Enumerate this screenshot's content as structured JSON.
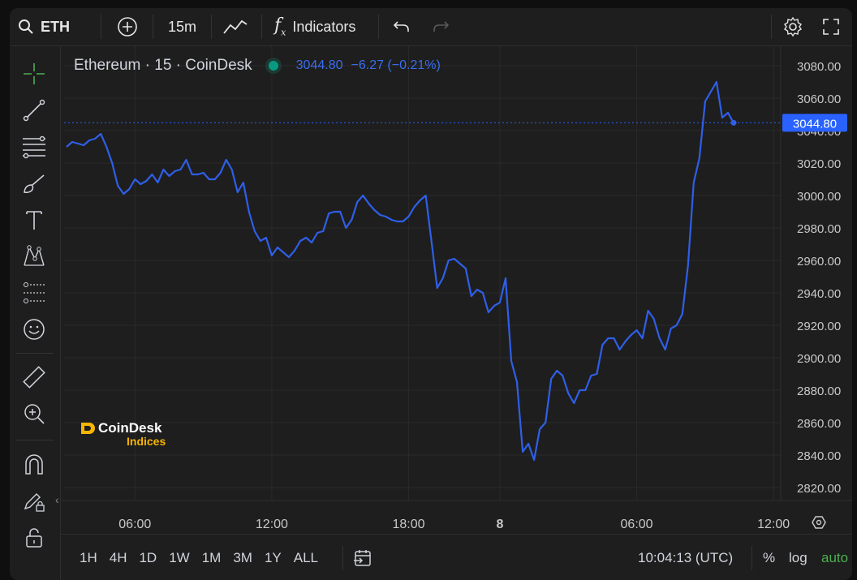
{
  "toolbar": {
    "symbol": "ETH",
    "interval": "15m",
    "indicators_label": "Indicators"
  },
  "legend": {
    "title": "Ethereum · 15 · CoinDesk",
    "price": "3044.80",
    "change": "−6.27 (−0.21%)"
  },
  "logo": {
    "line1": "CoinDesk",
    "line2": "Indices"
  },
  "bottom": {
    "ranges": [
      "1H",
      "4H",
      "1D",
      "1W",
      "1M",
      "3M",
      "1Y",
      "ALL"
    ],
    "time": "10:04:13 (UTC)",
    "percent": "%",
    "log": "log",
    "auto": "auto"
  },
  "colors": {
    "line": "#2f5fe8",
    "accent_green": "#4caf50",
    "price_label_bg": "#2962ff"
  },
  "chart_data": {
    "type": "line",
    "title": "Ethereum · 15 · CoinDesk",
    "xlabel": "",
    "ylabel": "",
    "ylim": [
      2812,
      3092
    ],
    "y_ticks": [
      2820,
      2840,
      2860,
      2880,
      2900,
      2920,
      2940,
      2960,
      2980,
      3000,
      3020,
      3040,
      3060,
      3080
    ],
    "y_tick_labels": [
      "2820.00",
      "2840.00",
      "2860.00",
      "2880.00",
      "2900.00",
      "2920.00",
      "2940.00",
      "2960.00",
      "2980.00",
      "3000.00",
      "3020.00",
      "3040.00",
      "3060.00",
      "3080.00"
    ],
    "x_tick_labels": [
      "06:00",
      "12:00",
      "18:00",
      "8",
      "06:00",
      "12:00"
    ],
    "x_tick_index": [
      12,
      36,
      60,
      76,
      100,
      124
    ],
    "last_price": 3044.8,
    "last_price_label": "3044.80",
    "grid": true,
    "series": [
      {
        "values": [
          3030,
          3033,
          3032,
          3031,
          3034,
          3035,
          3038,
          3030,
          3020,
          3006,
          3001,
          3004,
          3010,
          3007,
          3009,
          3013,
          3008,
          3016,
          3012,
          3015,
          3016,
          3022,
          3013,
          3013,
          3014,
          3010,
          3010,
          3014,
          3022,
          3016,
          3002,
          3008,
          2990,
          2978,
          2972,
          2974,
          2963,
          2968,
          2965,
          2962,
          2966,
          2972,
          2974,
          2971,
          2977,
          2978,
          2989,
          2990,
          2990,
          2980,
          2985,
          2996,
          3000,
          2995,
          2991,
          2988,
          2987,
          2985,
          2984,
          2984,
          2987,
          2993,
          2997,
          3000,
          2972,
          2943,
          2949,
          2960,
          2961,
          2958,
          2955,
          2938,
          2942,
          2940,
          2928,
          2932,
          2934,
          2949,
          2898,
          2885,
          2842,
          2847,
          2837,
          2856,
          2860,
          2887,
          2892,
          2889,
          2878,
          2872,
          2880,
          2880,
          2889,
          2890,
          2908,
          2912,
          2912,
          2905,
          2910,
          2914,
          2917,
          2912,
          2929,
          2924,
          2912,
          2905,
          2918,
          2920,
          2927,
          2957,
          3008,
          3023,
          3058,
          3064,
          3070,
          3048,
          3051,
          3044.8
        ]
      }
    ]
  }
}
